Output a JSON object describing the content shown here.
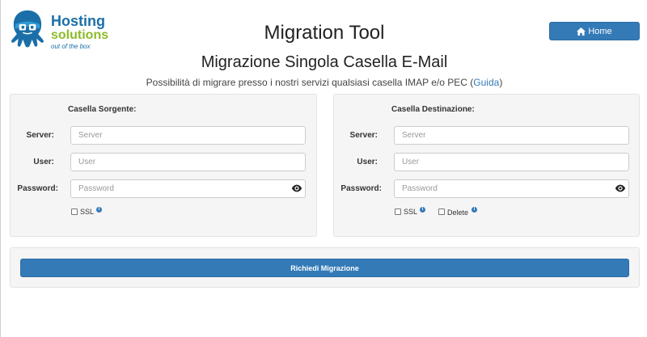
{
  "logo": {
    "line1": "Hosting",
    "line2": "solutions",
    "tagline": "out of the box"
  },
  "header": {
    "title": "Migration Tool",
    "home_label": "Home"
  },
  "page": {
    "subtitle": "Migrazione Singola Casella E-Mail",
    "description": "Possibilità di migrare presso i nostri servizi qualsiasi casella IMAP e/o PEC (",
    "guide_link": "Guida",
    "description_end": ")"
  },
  "source": {
    "title": "Casella Sorgente:",
    "server_label": "Server:",
    "server_placeholder": "Server",
    "user_label": "User:",
    "user_placeholder": "User",
    "password_label": "Password:",
    "password_placeholder": "Password",
    "ssl_label": "SSL"
  },
  "destination": {
    "title": "Casella Destinazione:",
    "server_label": "Server:",
    "server_placeholder": "Server",
    "user_label": "User:",
    "user_placeholder": "User",
    "password_label": "Password:",
    "password_placeholder": "Password",
    "ssl_label": "SSL",
    "delete_label": "Delete"
  },
  "actions": {
    "submit_label": "Richiedi Migrazione"
  },
  "colors": {
    "primary": "#337ab7",
    "logo_blue": "#1b6fa8",
    "logo_green": "#8dbb2a",
    "panel_bg": "#f5f5f5"
  }
}
